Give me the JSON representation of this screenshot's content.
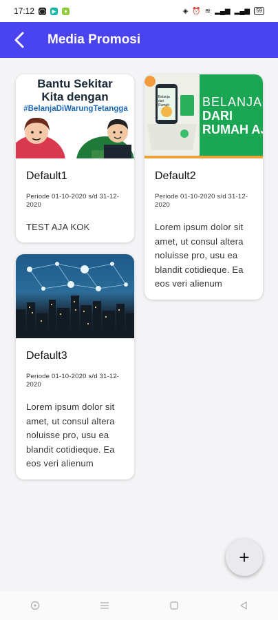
{
  "status": {
    "time": "17:12",
    "battery": "59"
  },
  "appbar": {
    "title": "Media Promosi"
  },
  "cards": [
    {
      "name": "Default1",
      "period": "Periode 01-10-2020 s/d 31-12-2020",
      "desc": "TEST AJA KOK",
      "image_text": {
        "line1": "Bantu Sekitar",
        "line2": "Kita dengan",
        "line3": "#BelanjaDiWarungTetangga"
      }
    },
    {
      "name": "Default2",
      "period": "Periode 01-10-2020 s/d 31-12-2020",
      "desc": "Lorem ipsum dolor sit amet, ut consul altera noluisse pro, usu ea blandit cotidieque. Ea eos veri alienum",
      "image_text": {
        "line1": "BELANJA",
        "line2": "DARI",
        "line3": "RUMAH AJA",
        "phone": "Belanja dari Rumah"
      }
    },
    {
      "name": "Default3",
      "period": "Periode 01-10-2020 s/d 31-12-2020",
      "desc": "Lorem ipsum dolor sit amet, ut consul altera noluisse pro, usu ea blandit cotidieque. Ea eos veri alienum"
    }
  ],
  "fab": {
    "label": "+"
  },
  "colors": {
    "primary": "#4a44f0",
    "green": "#1aa653"
  }
}
